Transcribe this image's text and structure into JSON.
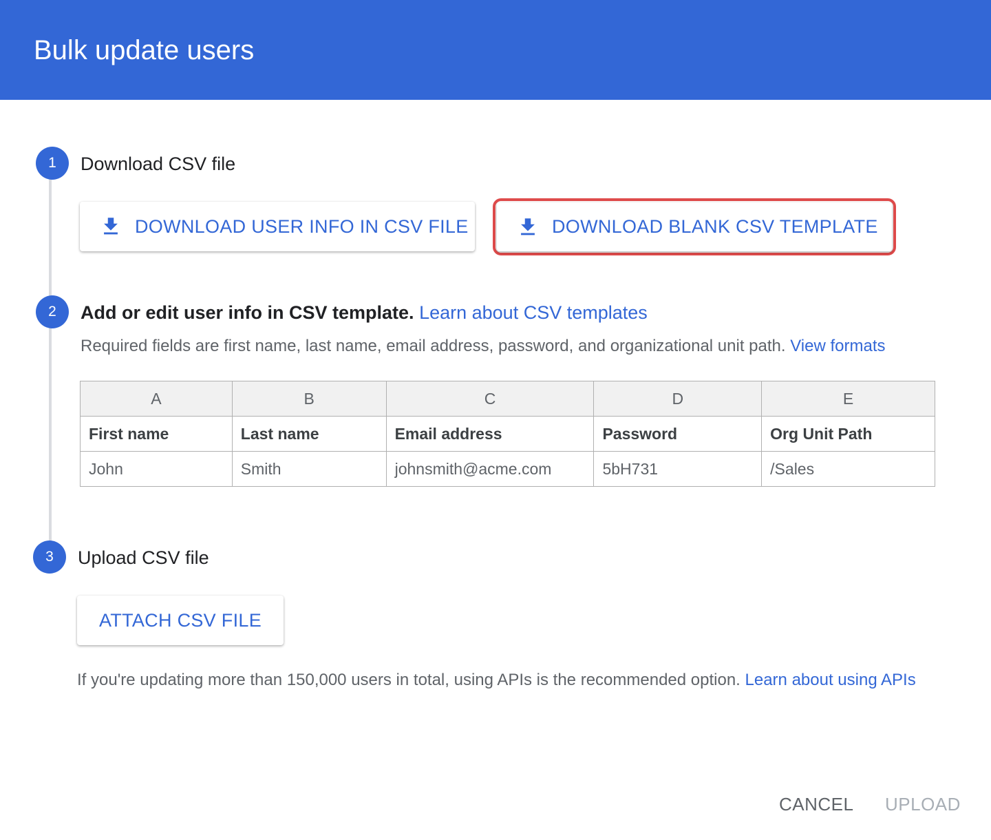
{
  "dialog": {
    "title": "Bulk update users"
  },
  "step1": {
    "number": "1",
    "title": "Download CSV file",
    "download_user_info_label": "DOWNLOAD USER INFO IN CSV FILE",
    "download_blank_template_label": "DOWNLOAD BLANK CSV TEMPLATE"
  },
  "step2": {
    "number": "2",
    "title": "Add or edit user info in CSV template.",
    "link": "Learn about CSV templates",
    "description": "Required fields are first name, last name, email address, password, and organizational unit path.",
    "description_link": "View formats",
    "sheet": {
      "columns": [
        "A",
        "B",
        "C",
        "D",
        "E"
      ],
      "header_row": [
        "First name",
        "Last name",
        "Email address",
        "Password",
        "Org Unit Path"
      ],
      "example_row": [
        "John",
        "Smith",
        "johnsmith@acme.com",
        "5bH731",
        "/Sales"
      ]
    }
  },
  "step3": {
    "number": "3",
    "title": "Upload CSV file",
    "attach_label": "ATTACH CSV FILE",
    "note": "If you're updating more than 150,000 users in total, using APIs is the recommended option.",
    "note_link": "Learn about using APIs"
  },
  "actions": {
    "cancel": "CANCEL",
    "upload": "UPLOAD"
  },
  "colors": {
    "primary": "#3367d6",
    "highlight": "#de4b4b"
  },
  "icons": {
    "download": "download-icon"
  }
}
